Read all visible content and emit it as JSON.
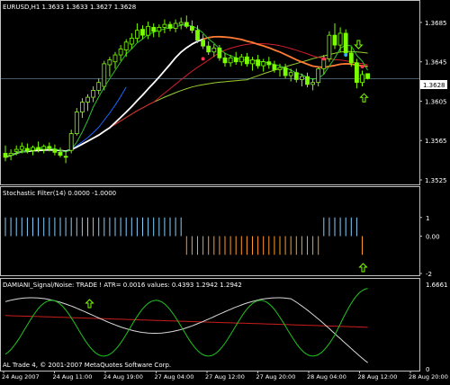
{
  "colors": {
    "background": "#000000",
    "frame": "#c0c0c0",
    "text": "#ffffff",
    "candle": "#7cfc00",
    "wick": "#7cfc00",
    "ma_fast": "#1e64ff",
    "ma_white": "#ffffff",
    "ma_orange": "#ff7a33",
    "ma_red": "#d21e2e",
    "ma_yellowgreen": "#9acd32",
    "ma_green": "#2fbf2f",
    "stoch_up": "#87cefa",
    "stoch_down": "#ff9a2a",
    "arrow": "#7cfc00",
    "dot_red": "#ff3355",
    "dot_blue": "#33aaff",
    "noise_white": "#d8d8d8",
    "noise_green": "#21c421",
    "noise_red": "#c81e1e",
    "price_line": "#7090b0"
  },
  "chart_data": [
    {
      "type": "candlestick",
      "title": "EURUSD,H1  1.3633  1.3633  1.3627  1.3628",
      "ylim": [
        1.3525,
        1.3695
      ],
      "y_ticks": [
        "1.3685",
        "1.3645",
        "1.3605",
        "1.3565",
        "1.3525"
      ],
      "current_price": "1.3628",
      "current_price_value": 1.3628,
      "candles": [
        [
          1.3552,
          1.356,
          1.3544,
          1.3548
        ],
        [
          1.355,
          1.3556,
          1.3545,
          1.3552
        ],
        [
          1.3554,
          1.356,
          1.355,
          1.3556
        ],
        [
          1.3556,
          1.3563,
          1.3552,
          1.3559
        ],
        [
          1.3557,
          1.3562,
          1.3552,
          1.3555
        ],
        [
          1.3555,
          1.356,
          1.355,
          1.3558
        ],
        [
          1.3558,
          1.3564,
          1.3553,
          1.3556
        ],
        [
          1.3556,
          1.3561,
          1.3552,
          1.3559
        ],
        [
          1.3559,
          1.3563,
          1.3554,
          1.3557
        ],
        [
          1.3556,
          1.3561,
          1.355,
          1.3553
        ],
        [
          1.3553,
          1.3558,
          1.3548,
          1.355
        ],
        [
          1.3549,
          1.3555,
          1.3542,
          1.3548
        ],
        [
          1.3555,
          1.3576,
          1.3552,
          1.3572
        ],
        [
          1.3572,
          1.3598,
          1.357,
          1.3594
        ],
        [
          1.3594,
          1.3608,
          1.3588,
          1.3604
        ],
        [
          1.3604,
          1.3612,
          1.3595,
          1.3609
        ],
        [
          1.3609,
          1.362,
          1.3604,
          1.3616
        ],
        [
          1.3616,
          1.3628,
          1.3612,
          1.3624
        ],
        [
          1.362,
          1.3646,
          1.3616,
          1.3643
        ],
        [
          1.3642,
          1.365,
          1.363,
          1.3647
        ],
        [
          1.3645,
          1.3655,
          1.3638,
          1.3652
        ],
        [
          1.3652,
          1.3662,
          1.3646,
          1.3658
        ],
        [
          1.3657,
          1.3668,
          1.365,
          1.3665
        ],
        [
          1.3663,
          1.3674,
          1.3658,
          1.3669
        ],
        [
          1.3669,
          1.3684,
          1.3665,
          1.3677
        ],
        [
          1.3678,
          1.3682,
          1.3668,
          1.3672
        ],
        [
          1.3672,
          1.3686,
          1.3668,
          1.3681
        ],
        [
          1.368,
          1.3684,
          1.367,
          1.3676
        ],
        [
          1.3676,
          1.3683,
          1.367,
          1.368
        ],
        [
          1.368,
          1.3688,
          1.3674,
          1.3683
        ],
        [
          1.3683,
          1.3686,
          1.3676,
          1.3679
        ],
        [
          1.3679,
          1.3688,
          1.3675,
          1.3684
        ],
        [
          1.3683,
          1.369,
          1.3678,
          1.3685
        ],
        [
          1.3685,
          1.3692,
          1.3679,
          1.3681
        ],
        [
          1.3681,
          1.3687,
          1.3674,
          1.3677
        ],
        [
          1.3677,
          1.3682,
          1.3664,
          1.3667
        ],
        [
          1.3667,
          1.3673,
          1.3658,
          1.3661
        ],
        [
          1.3661,
          1.3666,
          1.3652,
          1.3655
        ],
        [
          1.3655,
          1.3663,
          1.365,
          1.3659
        ],
        [
          1.3659,
          1.3662,
          1.3646,
          1.3649
        ],
        [
          1.3649,
          1.3654,
          1.364,
          1.3644
        ],
        [
          1.3644,
          1.3652,
          1.364,
          1.3649
        ],
        [
          1.3649,
          1.3655,
          1.3642,
          1.3645
        ],
        [
          1.3645,
          1.3653,
          1.3641,
          1.365
        ],
        [
          1.365,
          1.3654,
          1.364,
          1.3643
        ],
        [
          1.3643,
          1.365,
          1.3636,
          1.3647
        ],
        [
          1.3647,
          1.3652,
          1.3638,
          1.3641
        ],
        [
          1.3641,
          1.3648,
          1.3635,
          1.3645
        ],
        [
          1.3645,
          1.365,
          1.3638,
          1.3642
        ],
        [
          1.3642,
          1.3646,
          1.3634,
          1.3637
        ],
        [
          1.3637,
          1.3643,
          1.363,
          1.3639
        ],
        [
          1.3639,
          1.3643,
          1.3628,
          1.3631
        ],
        [
          1.3631,
          1.3638,
          1.3625,
          1.3634
        ],
        [
          1.3634,
          1.3638,
          1.3624,
          1.3627
        ],
        [
          1.3627,
          1.3633,
          1.362,
          1.363
        ],
        [
          1.363,
          1.3634,
          1.3619,
          1.3622
        ],
        [
          1.3622,
          1.3628,
          1.3616,
          1.3624
        ],
        [
          1.3624,
          1.364,
          1.362,
          1.3638
        ],
        [
          1.3638,
          1.3652,
          1.3632,
          1.3648
        ],
        [
          1.3648,
          1.3676,
          1.3645,
          1.3672
        ],
        [
          1.3672,
          1.3684,
          1.3658,
          1.3662
        ],
        [
          1.3662,
          1.368,
          1.3655,
          1.3674
        ],
        [
          1.3674,
          1.3678,
          1.365,
          1.3654
        ],
        [
          1.3654,
          1.366,
          1.364,
          1.3644
        ],
        [
          1.3644,
          1.3648,
          1.3618,
          1.3624
        ],
        [
          1.3624,
          1.3636,
          1.362,
          1.3632
        ],
        [
          1.3633,
          1.3633,
          1.3627,
          1.3628
        ]
      ],
      "signal_arrows": [
        {
          "bar": 64,
          "price": 1.3663,
          "direction": "down"
        },
        {
          "bar": 65,
          "price": 1.3608,
          "direction": "up"
        }
      ]
    },
    {
      "type": "histogram",
      "title": "Stochastic Filter(14) 0.0000 -1.0000",
      "ylim": [
        -2,
        2
      ],
      "y_ticks": [
        "1",
        "0.00",
        "-2"
      ],
      "up_bars": [
        0,
        32
      ],
      "up_bars_2": [
        58,
        64
      ],
      "down_bars": [
        33,
        57
      ],
      "down_bars_2": [
        65,
        65
      ],
      "up_arrow_bar": 65
    },
    {
      "type": "line",
      "title": "DAMIANI_Signal/Noise: TRADE !   ATR= 0.0016   values: 0.4393  1.2942  1.2942",
      "ylim": [
        0,
        1.6661
      ],
      "y_ticks": [
        "1.6661",
        "0"
      ]
    }
  ],
  "x_axis": {
    "labels": [
      "24 Aug 2007",
      "24 Aug 11:00",
      "24 Aug 19:00",
      "27 Aug 04:00",
      "27 Aug 12:00",
      "27 Aug 20:00",
      "28 Aug 04:00",
      "28 Aug 12:00",
      "28 Aug 20:00"
    ]
  },
  "copyright": "AL Trade 4, © 2001-2007 MetaQuotes Software Corp."
}
